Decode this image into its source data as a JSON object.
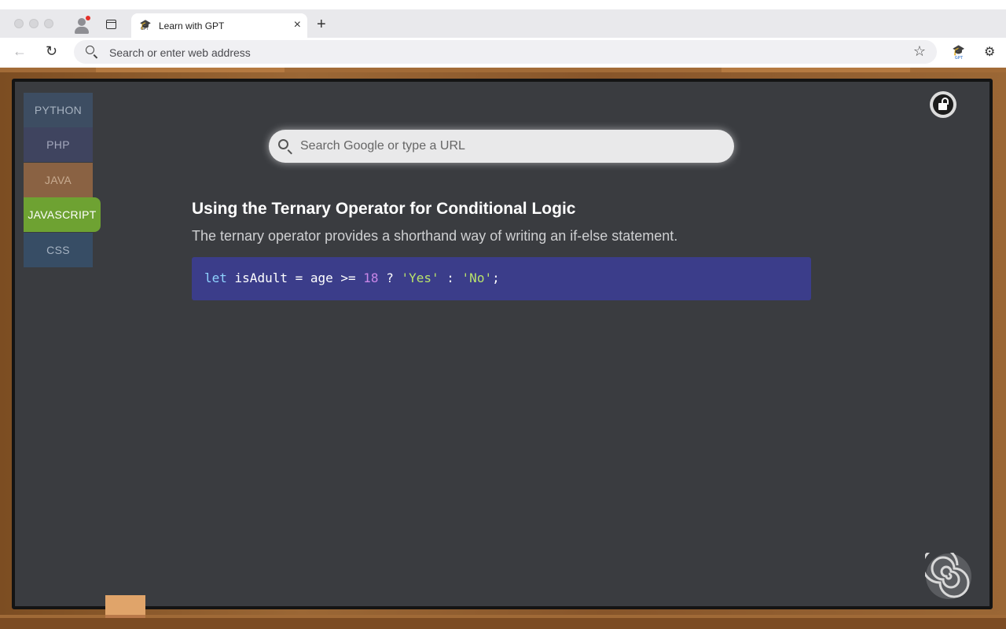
{
  "browser": {
    "tab": {
      "title": "Learn with GPT",
      "icon_text": "GPT"
    },
    "address_placeholder": "Search or enter web address",
    "extension_icon_text": "GPT"
  },
  "sidebar": {
    "languages": [
      {
        "label": "PYTHON",
        "active": false
      },
      {
        "label": "PHP",
        "active": false
      },
      {
        "label": "JAVA",
        "active": false
      },
      {
        "label": "JAVASCRIPT",
        "active": true
      },
      {
        "label": "CSS",
        "active": false
      }
    ]
  },
  "search": {
    "placeholder": "Search Google or type a URL"
  },
  "lesson": {
    "title": "Using the Ternary Operator for Conditional Logic",
    "description": "The ternary operator provides a shorthand way of writing an if-else statement.",
    "code": {
      "keyword": "let",
      "part1": " isAdult = age >= ",
      "number": "18",
      "part2": " ? ",
      "str1": "'Yes'",
      "part3": " : ",
      "str2": "'No'",
      "part4": ";"
    }
  },
  "colors": {
    "board": "#3a3c40",
    "frame": "#8b5a2b",
    "active_language": "#6ea232",
    "code_background": "#3b3d8a"
  },
  "icons": [
    "profile-icon",
    "sidebar-toggle-icon",
    "graduation-cap-icon",
    "close-icon",
    "plus-icon",
    "back-arrow-icon",
    "reload-icon",
    "search-icon",
    "star-icon",
    "puzzle-icon",
    "lock-icon",
    "spiral-logo-icon"
  ]
}
